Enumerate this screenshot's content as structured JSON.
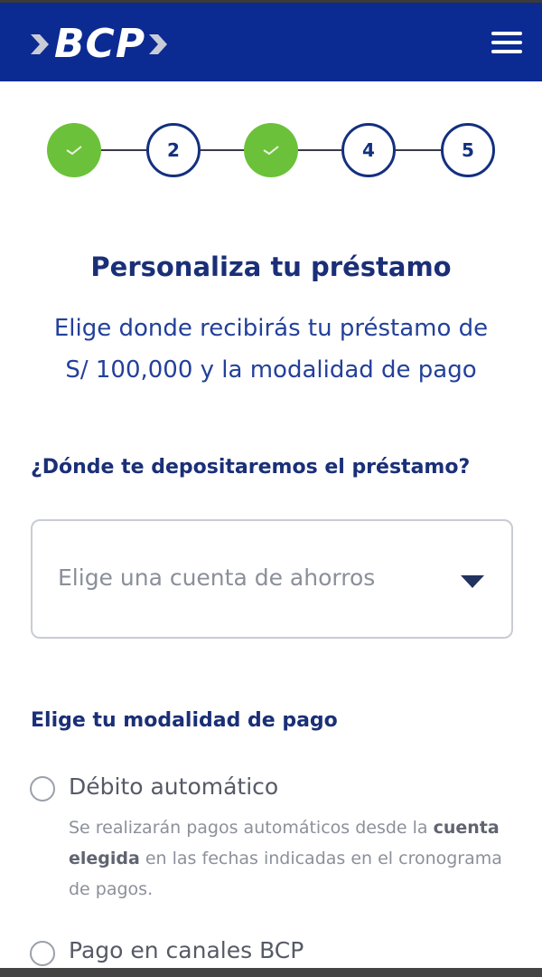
{
  "header": {
    "logo_text": "BCP",
    "brand_color": "#0b2b93",
    "menu_icon": "hamburger-menu-icon"
  },
  "stepper": {
    "steps": [
      {
        "label": "",
        "state": "done"
      },
      {
        "label": "2",
        "state": "pending"
      },
      {
        "label": "",
        "state": "done"
      },
      {
        "label": "4",
        "state": "pending"
      },
      {
        "label": "5",
        "state": "pending"
      }
    ],
    "done_color": "#6cc13a",
    "pending_border_color": "#13307f"
  },
  "main": {
    "title": "Personaliza tu préstamo",
    "subtitle_line1": "Elige donde recibirás tu préstamo de",
    "subtitle_line2": "S/ 100,000 y la modalidad de pago",
    "deposit_question": "¿Dónde te depositaremos el préstamo?",
    "account_select_placeholder": "Elige una cuenta de ahorros",
    "payment_label": "Elige tu modalidad de pago",
    "options": [
      {
        "label": "Débito automático",
        "desc_part1": "Se realizarán pagos automáticos desde la ",
        "desc_bold": "cuenta elegida",
        "desc_part2": " en las fechas indicadas en el cronograma de pagos."
      },
      {
        "label": "Pago en canales BCP"
      }
    ]
  }
}
